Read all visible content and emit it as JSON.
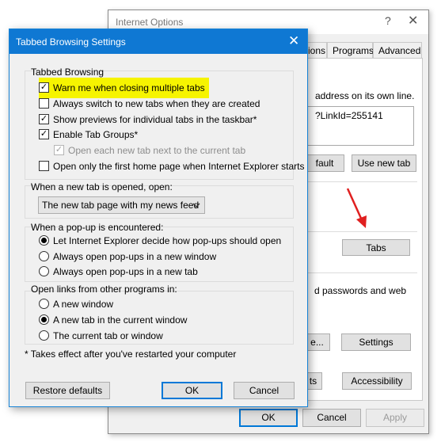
{
  "internet_options": {
    "title": "Internet Options",
    "help_glyph": "?",
    "close_glyph": "✕",
    "tabs": [
      "ions",
      "Programs",
      "Advanced"
    ],
    "home_page_text": "address on its own line.",
    "home_page_url": "?LinkId=255141",
    "use_default_label": "fault",
    "use_new_tab_label": "Use new tab",
    "tabs_button_label": "Tabs",
    "passwords_text": "d passwords and web",
    "languages_label": "e...",
    "settings_label": "Settings",
    "fonts_label": "ts",
    "accessibility_label": "Accessibility",
    "ok_label": "OK",
    "cancel_label": "Cancel",
    "apply_label": "Apply"
  },
  "dialog": {
    "title": "Tabbed Browsing Settings",
    "close_glyph": "✕",
    "tabbed_browsing": {
      "label": "Tabbed Browsing",
      "options": [
        {
          "label": "Warn me when closing multiple tabs",
          "checked": true,
          "highlighted": true
        },
        {
          "label": "Always switch to new tabs when they are created",
          "checked": false
        },
        {
          "label": "Show previews for individual tabs in the taskbar*",
          "checked": true
        },
        {
          "label": "Enable Tab Groups*",
          "checked": true
        },
        {
          "label": "Open each new tab next to the current tab",
          "checked": true,
          "disabled": true
        },
        {
          "label": "Open only the first home page when Internet Explorer starts",
          "checked": false
        }
      ]
    },
    "new_tab": {
      "label": "When a new tab is opened, open:",
      "selected": "The new tab page with my news feed"
    },
    "popup": {
      "label": "When a pop-up is encountered:",
      "options": [
        {
          "label": "Let Internet Explorer decide how pop-ups should open",
          "selected": true
        },
        {
          "label": "Always open pop-ups in a new window",
          "selected": false
        },
        {
          "label": "Always open pop-ups in a new tab",
          "selected": false
        }
      ]
    },
    "open_links": {
      "label": "Open links from other programs in:",
      "options": [
        {
          "label": "A new window",
          "selected": false
        },
        {
          "label": "A new tab in the current window",
          "selected": true
        },
        {
          "label": "The current tab or window",
          "selected": false
        }
      ]
    },
    "footnote": "* Takes effect after you've restarted your computer",
    "restore_defaults_label": "Restore defaults",
    "ok_label": "OK",
    "cancel_label": "Cancel"
  },
  "colors": {
    "dialog_titlebar": "#0f78d3",
    "highlight": "#f6f400",
    "arrow": "#e02020"
  }
}
